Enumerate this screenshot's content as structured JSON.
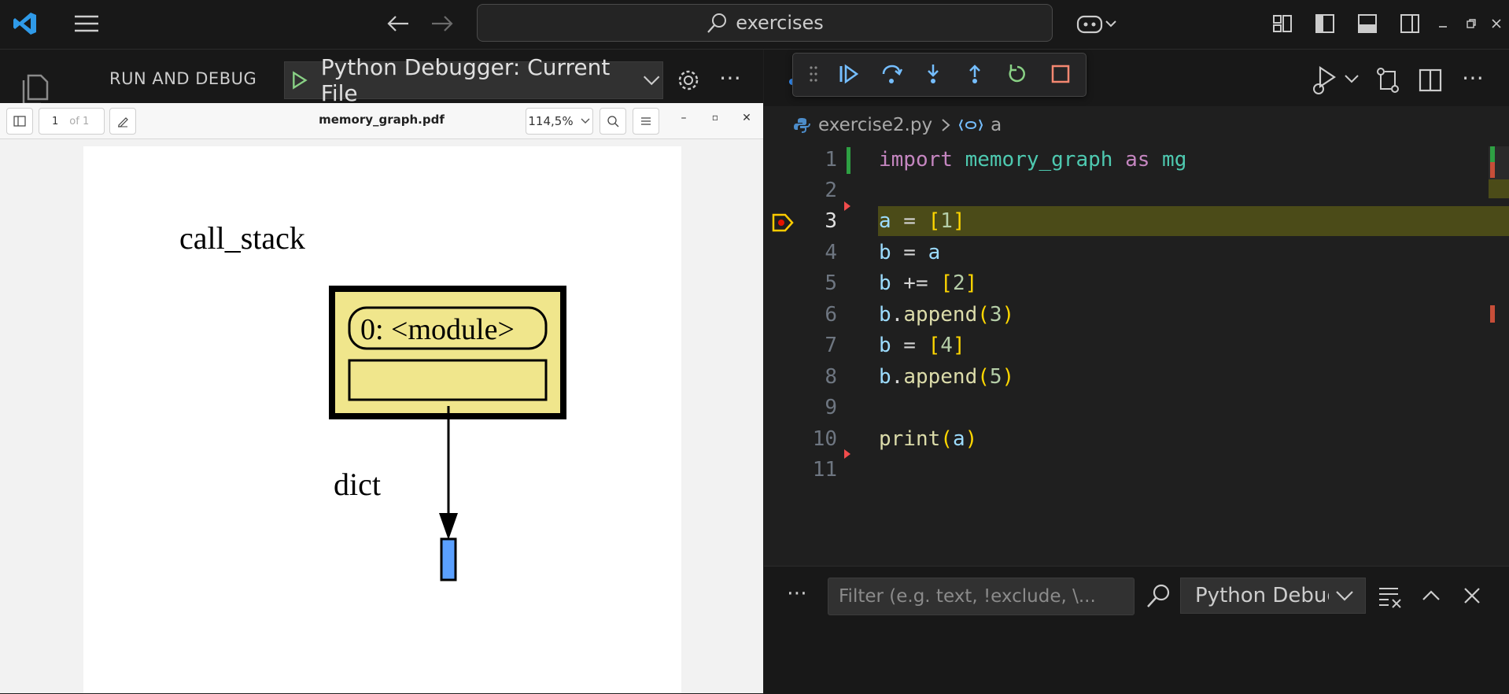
{
  "titlebar": {
    "search_text": "exercises"
  },
  "sidebar": {
    "title": "RUN AND DEBUG",
    "config": "Python Debugger: Current File"
  },
  "pdf": {
    "page_value": "1",
    "page_total": "of 1",
    "filename": "memory_graph.pdf",
    "zoom": "114,5%",
    "graph": {
      "call_stack_label": "call_stack",
      "frame_label": "0: <module>",
      "dict_label": "dict",
      "frame_fill": "#f0e68c",
      "dict_fill": "#5aa0ff"
    }
  },
  "editor": {
    "breadcrumb": {
      "file": "exercise2.py",
      "symbol": "a"
    },
    "line_numbers": [
      "1",
      "2",
      "3",
      "4",
      "5",
      "6",
      "7",
      "8",
      "9",
      "10",
      "11"
    ],
    "current_line": "3"
  },
  "panel": {
    "filter_placeholder": "Filter (e.g. text, !exclude, \\...",
    "select_value": "Python Debugger"
  },
  "colors": {
    "accent": "#3794ff",
    "current_line_bg": "#4b4b18",
    "run_green": "#89d185",
    "stop_red": "#f48771"
  }
}
